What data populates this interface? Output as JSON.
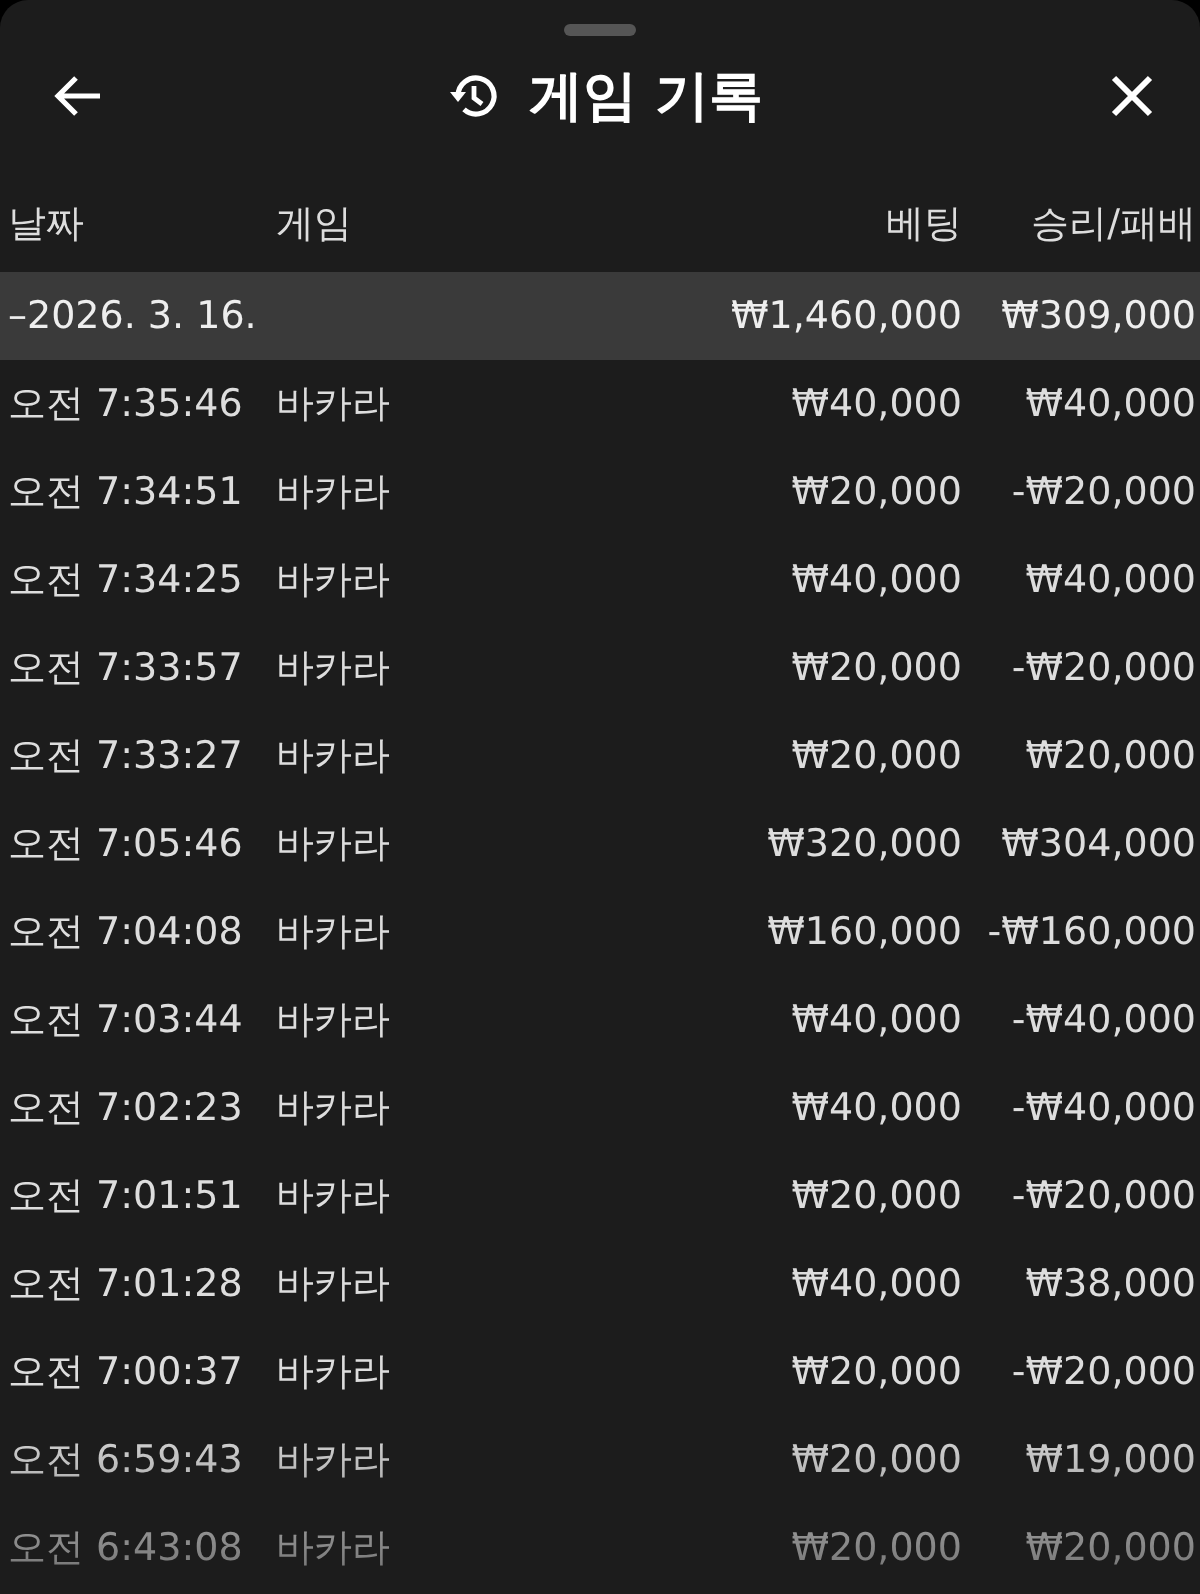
{
  "header": {
    "title": "게임 기록"
  },
  "columns": [
    "날짜",
    "게임",
    "베팅",
    "승리/패배"
  ],
  "group": {
    "toggle": "–",
    "date": "2026. 3. 16.",
    "bet": "₩1,460,000",
    "result": "₩309,000"
  },
  "rows": [
    {
      "time": "오전 7:35:46",
      "game": "바카라",
      "bet": "₩40,000",
      "result": "₩40,000"
    },
    {
      "time": "오전 7:34:51",
      "game": "바카라",
      "bet": "₩20,000",
      "result": "-₩20,000"
    },
    {
      "time": "오전 7:34:25",
      "game": "바카라",
      "bet": "₩40,000",
      "result": "₩40,000"
    },
    {
      "time": "오전 7:33:57",
      "game": "바카라",
      "bet": "₩20,000",
      "result": "-₩20,000"
    },
    {
      "time": "오전 7:33:27",
      "game": "바카라",
      "bet": "₩20,000",
      "result": "₩20,000"
    },
    {
      "time": "오전 7:05:46",
      "game": "바카라",
      "bet": "₩320,000",
      "result": "₩304,000"
    },
    {
      "time": "오전 7:04:08",
      "game": "바카라",
      "bet": "₩160,000",
      "result": "-₩160,000"
    },
    {
      "time": "오전 7:03:44",
      "game": "바카라",
      "bet": "₩40,000",
      "result": "-₩40,000"
    },
    {
      "time": "오전 7:02:23",
      "game": "바카라",
      "bet": "₩40,000",
      "result": "-₩40,000"
    },
    {
      "time": "오전 7:01:51",
      "game": "바카라",
      "bet": "₩20,000",
      "result": "-₩20,000"
    },
    {
      "time": "오전 7:01:28",
      "game": "바카라",
      "bet": "₩40,000",
      "result": "₩38,000"
    },
    {
      "time": "오전 7:00:37",
      "game": "바카라",
      "bet": "₩20,000",
      "result": "-₩20,000"
    },
    {
      "time": "오전 6:59:43",
      "game": "바카라",
      "bet": "₩20,000",
      "result": "₩19,000"
    },
    {
      "time": "오전 6:43:08",
      "game": "바카라",
      "bet": "₩20,000",
      "result": "₩20,000"
    }
  ]
}
